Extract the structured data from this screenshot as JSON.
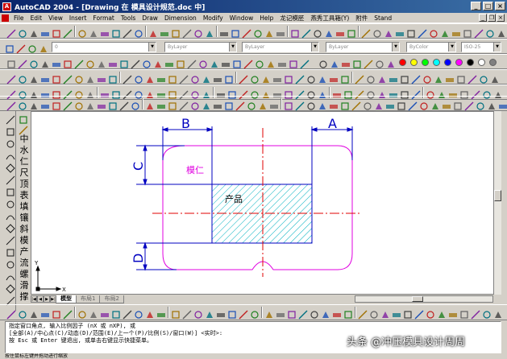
{
  "window": {
    "title": "AutoCAD 2004 - [Drawing 在 模具设计规范.doc 中]",
    "app_icon": "autocad-logo-icon",
    "buttons": [
      "minimize",
      "maximize",
      "close"
    ]
  },
  "menubar": {
    "items": [
      "File",
      "Edit",
      "View",
      "Insert",
      "Format",
      "Tools",
      "Draw",
      "Dimension",
      "Modify",
      "Window",
      "Help",
      "龙记模胚",
      "燕秀工具箱(Y)",
      "附件",
      "Stand"
    ]
  },
  "toolbars": {
    "layer_combo": "0",
    "color_combo": "ByLayer",
    "linetype_combo": "ByLayer",
    "lineweight_combo": "ByLayer",
    "plotstyle_combo": "ByColor",
    "dimstyle_combo": "ISO-25",
    "palette_colors": [
      "#ff0000",
      "#ffff00",
      "#00ff00",
      "#00ffff",
      "#0000ff",
      "#ff00ff",
      "#000000",
      "#ffffff",
      "#808080"
    ]
  },
  "left_palette": {
    "chars": [
      "中",
      "水",
      "仁",
      "尺",
      "顶",
      "表",
      "填",
      "镶",
      "斜",
      "模",
      "产",
      "流",
      "螺",
      "滑",
      "撑"
    ]
  },
  "drawing": {
    "label_product": "产品",
    "label_mold_core": "模仁",
    "dim_a": "A",
    "dim_b": "B",
    "dim_c": "C",
    "dim_d": "D",
    "axis_x": "X",
    "axis_y": "Y",
    "colors": {
      "outline": "#e000e0",
      "centerline": "#e00000",
      "dimension": "#0000c0",
      "hatch": "#00b0c0",
      "label": "#e000e0"
    }
  },
  "layout_tabs": {
    "tabs": [
      "模型",
      "布局1",
      "布局2"
    ],
    "active": "模型"
  },
  "command_line": {
    "lines": [
      "指定窗口角点, 输入比例因子 (nX 或 nXP), 或",
      "[全部(A)/中心点(C)/动态(D)/范围(E)/上一个(P)/比例(S)/窗口(W)] <实时>:",
      "按 Esc 或 Enter 键退出, 或单击右键显示快捷菜单。"
    ]
  },
  "status_bar": {
    "text": "按住鼠标左键并拖动进行缩放"
  },
  "watermark": {
    "text": "头条 @冲压模具设计周周"
  }
}
